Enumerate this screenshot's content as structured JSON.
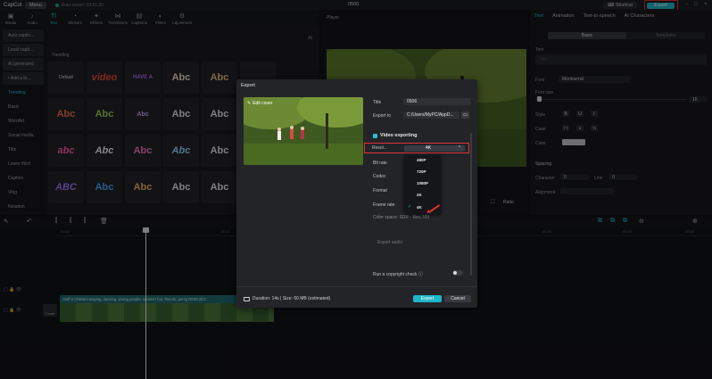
{
  "topbar": {
    "logo": "CapCut",
    "menu_label": "Menu",
    "autosave": "Auto saved: 09:51:30",
    "project_title": "0506",
    "shortcut_label": "Shortcut",
    "export_label": "Export"
  },
  "tools": [
    {
      "label": "Media",
      "icon": "media-icon"
    },
    {
      "label": "Audio",
      "icon": "audio-icon"
    },
    {
      "label": "Text",
      "icon": "text-icon"
    },
    {
      "label": "Stickers",
      "icon": "stickers-icon"
    },
    {
      "label": "Effects",
      "icon": "effects-icon"
    },
    {
      "label": "Transitions",
      "icon": "transitions-icon"
    },
    {
      "label": "Captions",
      "icon": "captions-icon"
    },
    {
      "label": "Filters",
      "icon": "filters-icon"
    },
    {
      "label": "Adjustment",
      "icon": "adjustment-icon"
    }
  ],
  "leftnav": [
    "Auto captio...",
    "Local capti...",
    "AI generated",
    "• Add a te...",
    "Trending",
    "Basic",
    "WordArt",
    "Social media",
    "Title",
    "Lower third",
    "Caption",
    "Vlog",
    "Notation"
  ],
  "textgrid": {
    "header": "Trending",
    "ai_label": "AI",
    "tiles": [
      "Default",
      "video",
      "HAVE A",
      "Abc",
      "Abc",
      "Abc",
      "Abc",
      "Abc",
      "Abc",
      "Abc",
      "abc",
      "Abc",
      "Abc",
      "Abc",
      "Abc",
      "ABC",
      "Abc",
      "Abc",
      "Abc",
      "Abc"
    ]
  },
  "player": {
    "label": "Player",
    "ratio_label": "Ratio"
  },
  "props": {
    "tabs": [
      "Text",
      "Animation",
      "Text-to-speech",
      "AI Characters"
    ],
    "seg_basic": "Basic",
    "seg_templates": "Templates",
    "section_text": "Text",
    "text_placeholder": "Title",
    "font_label": "Font",
    "font_value": "Montserrat",
    "font_size_label": "Font size",
    "font_size_value": "15",
    "style_label": "Style",
    "case_label": "Case",
    "color_label": "Color",
    "spacing_label": "Spacing",
    "character_label": "Character",
    "character_value": "0",
    "line_label": "Line",
    "line_value": "0",
    "alignment_label": "Alignment"
  },
  "timeline": {
    "ruler": [
      "00:00",
      "00:05",
      "00:10",
      "00:15",
      "00:20",
      "00:25",
      "00:30",
      "00:35",
      "00:40",
      "00:45"
    ],
    "cover_label": "Cover",
    "clip_caption": "Staff 6 Children playing, dancing, young people, summer fun, friends, get-tg 00:00:32:1"
  },
  "modal": {
    "title": "Export",
    "edit_cover": "Edit cover",
    "title_label": "Title",
    "title_value": "0506",
    "export_to_label": "Export to",
    "export_to_value": "C:/Users/MyPC/AppD...",
    "video_exporting": "Video exporting",
    "resolution_label": "Resol...",
    "resolution_value": "4K",
    "bitrate_label": "Bit rate",
    "codec_label": "Codec",
    "format_label": "Format",
    "framerate_label": "Frame rate",
    "colorspace_label": "Color space: SDR - Rec.709",
    "export_audio_label": "Export audio",
    "copyright_label": "Run a copyright check",
    "dropdown_options": [
      "480P",
      "720P",
      "1080P",
      "2K",
      "4K"
    ],
    "selected_option": "4K",
    "duration_text": "Duration: 14s | Size: 60 MB (estimated)",
    "export_button": "Export",
    "cancel_button": "Cancel"
  }
}
